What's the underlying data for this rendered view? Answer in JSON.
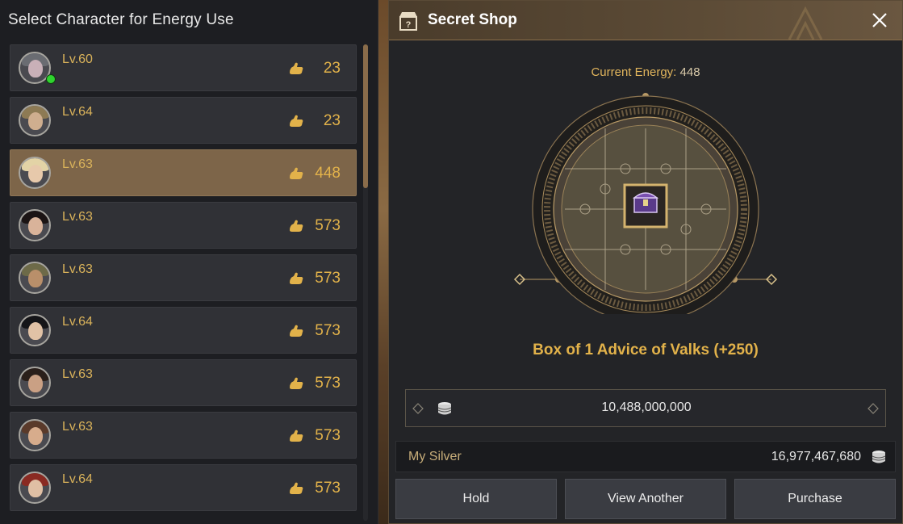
{
  "left_panel": {
    "title": "Select Character for Energy Use",
    "characters": [
      {
        "level": "Lv.60",
        "energy": "23",
        "online": true,
        "selected": false,
        "hair": "#6a6c72",
        "face": "#c9b0b8"
      },
      {
        "level": "Lv.64",
        "energy": "23",
        "online": false,
        "selected": false,
        "hair": "#8d7a54",
        "face": "#cfae8f"
      },
      {
        "level": "Lv.63",
        "energy": "448",
        "online": false,
        "selected": true,
        "hair": "#e3d3a6",
        "face": "#e7c9ab"
      },
      {
        "level": "Lv.63",
        "energy": "573",
        "online": false,
        "selected": false,
        "hair": "#1b1414",
        "face": "#d9b39a"
      },
      {
        "level": "Lv.63",
        "energy": "573",
        "online": false,
        "selected": false,
        "hair": "#6d6a48",
        "face": "#b98f6a"
      },
      {
        "level": "Lv.64",
        "energy": "573",
        "online": false,
        "selected": false,
        "hair": "#151518",
        "face": "#e1c2a6"
      },
      {
        "level": "Lv.63",
        "energy": "573",
        "online": false,
        "selected": false,
        "hair": "#2a1f1a",
        "face": "#caa084"
      },
      {
        "level": "Lv.63",
        "energy": "573",
        "online": false,
        "selected": false,
        "hair": "#5a3a2a",
        "face": "#d7ac8c"
      },
      {
        "level": "Lv.64",
        "energy": "573",
        "online": false,
        "selected": false,
        "hair": "#8a2a22",
        "face": "#e0bfa4"
      }
    ]
  },
  "shop": {
    "title": "Secret Shop",
    "energy_label": "Current Energy:",
    "energy_value": "448",
    "item_name": "Box of 1 Advice of Valks (+250)",
    "price": "10,488,000,000",
    "my_silver_label": "My Silver",
    "my_silver_value": "16,977,467,680",
    "buttons": {
      "hold": "Hold",
      "view_another": "View Another",
      "purchase": "Purchase"
    }
  },
  "icons": {
    "energy": "energy-hand-icon",
    "silver": "silver-coin-stack-icon",
    "shop": "shop-question-icon",
    "close": "close-icon",
    "item": "treasure-chest-icon"
  },
  "colors": {
    "accent_gold": "#e2b24a",
    "selected_row": "#7d6549",
    "online": "#2fd42f"
  }
}
